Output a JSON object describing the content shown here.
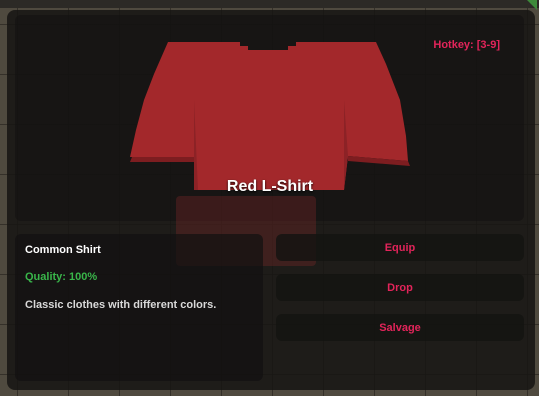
{
  "hotkey": "Hotkey: [3-9]",
  "item": {
    "name": "Red L-Shirt",
    "icon": "red-long-sleeve-shirt",
    "color": "#a3282b",
    "type": "Common Shirt",
    "quality": "Quality: 100%",
    "description": "Classic clothes with different colors."
  },
  "actions": {
    "equip": "Equip",
    "drop": "Drop",
    "salvage": "Salvage"
  },
  "colors": {
    "accent": "#e2245a",
    "quality": "#39b54a"
  }
}
